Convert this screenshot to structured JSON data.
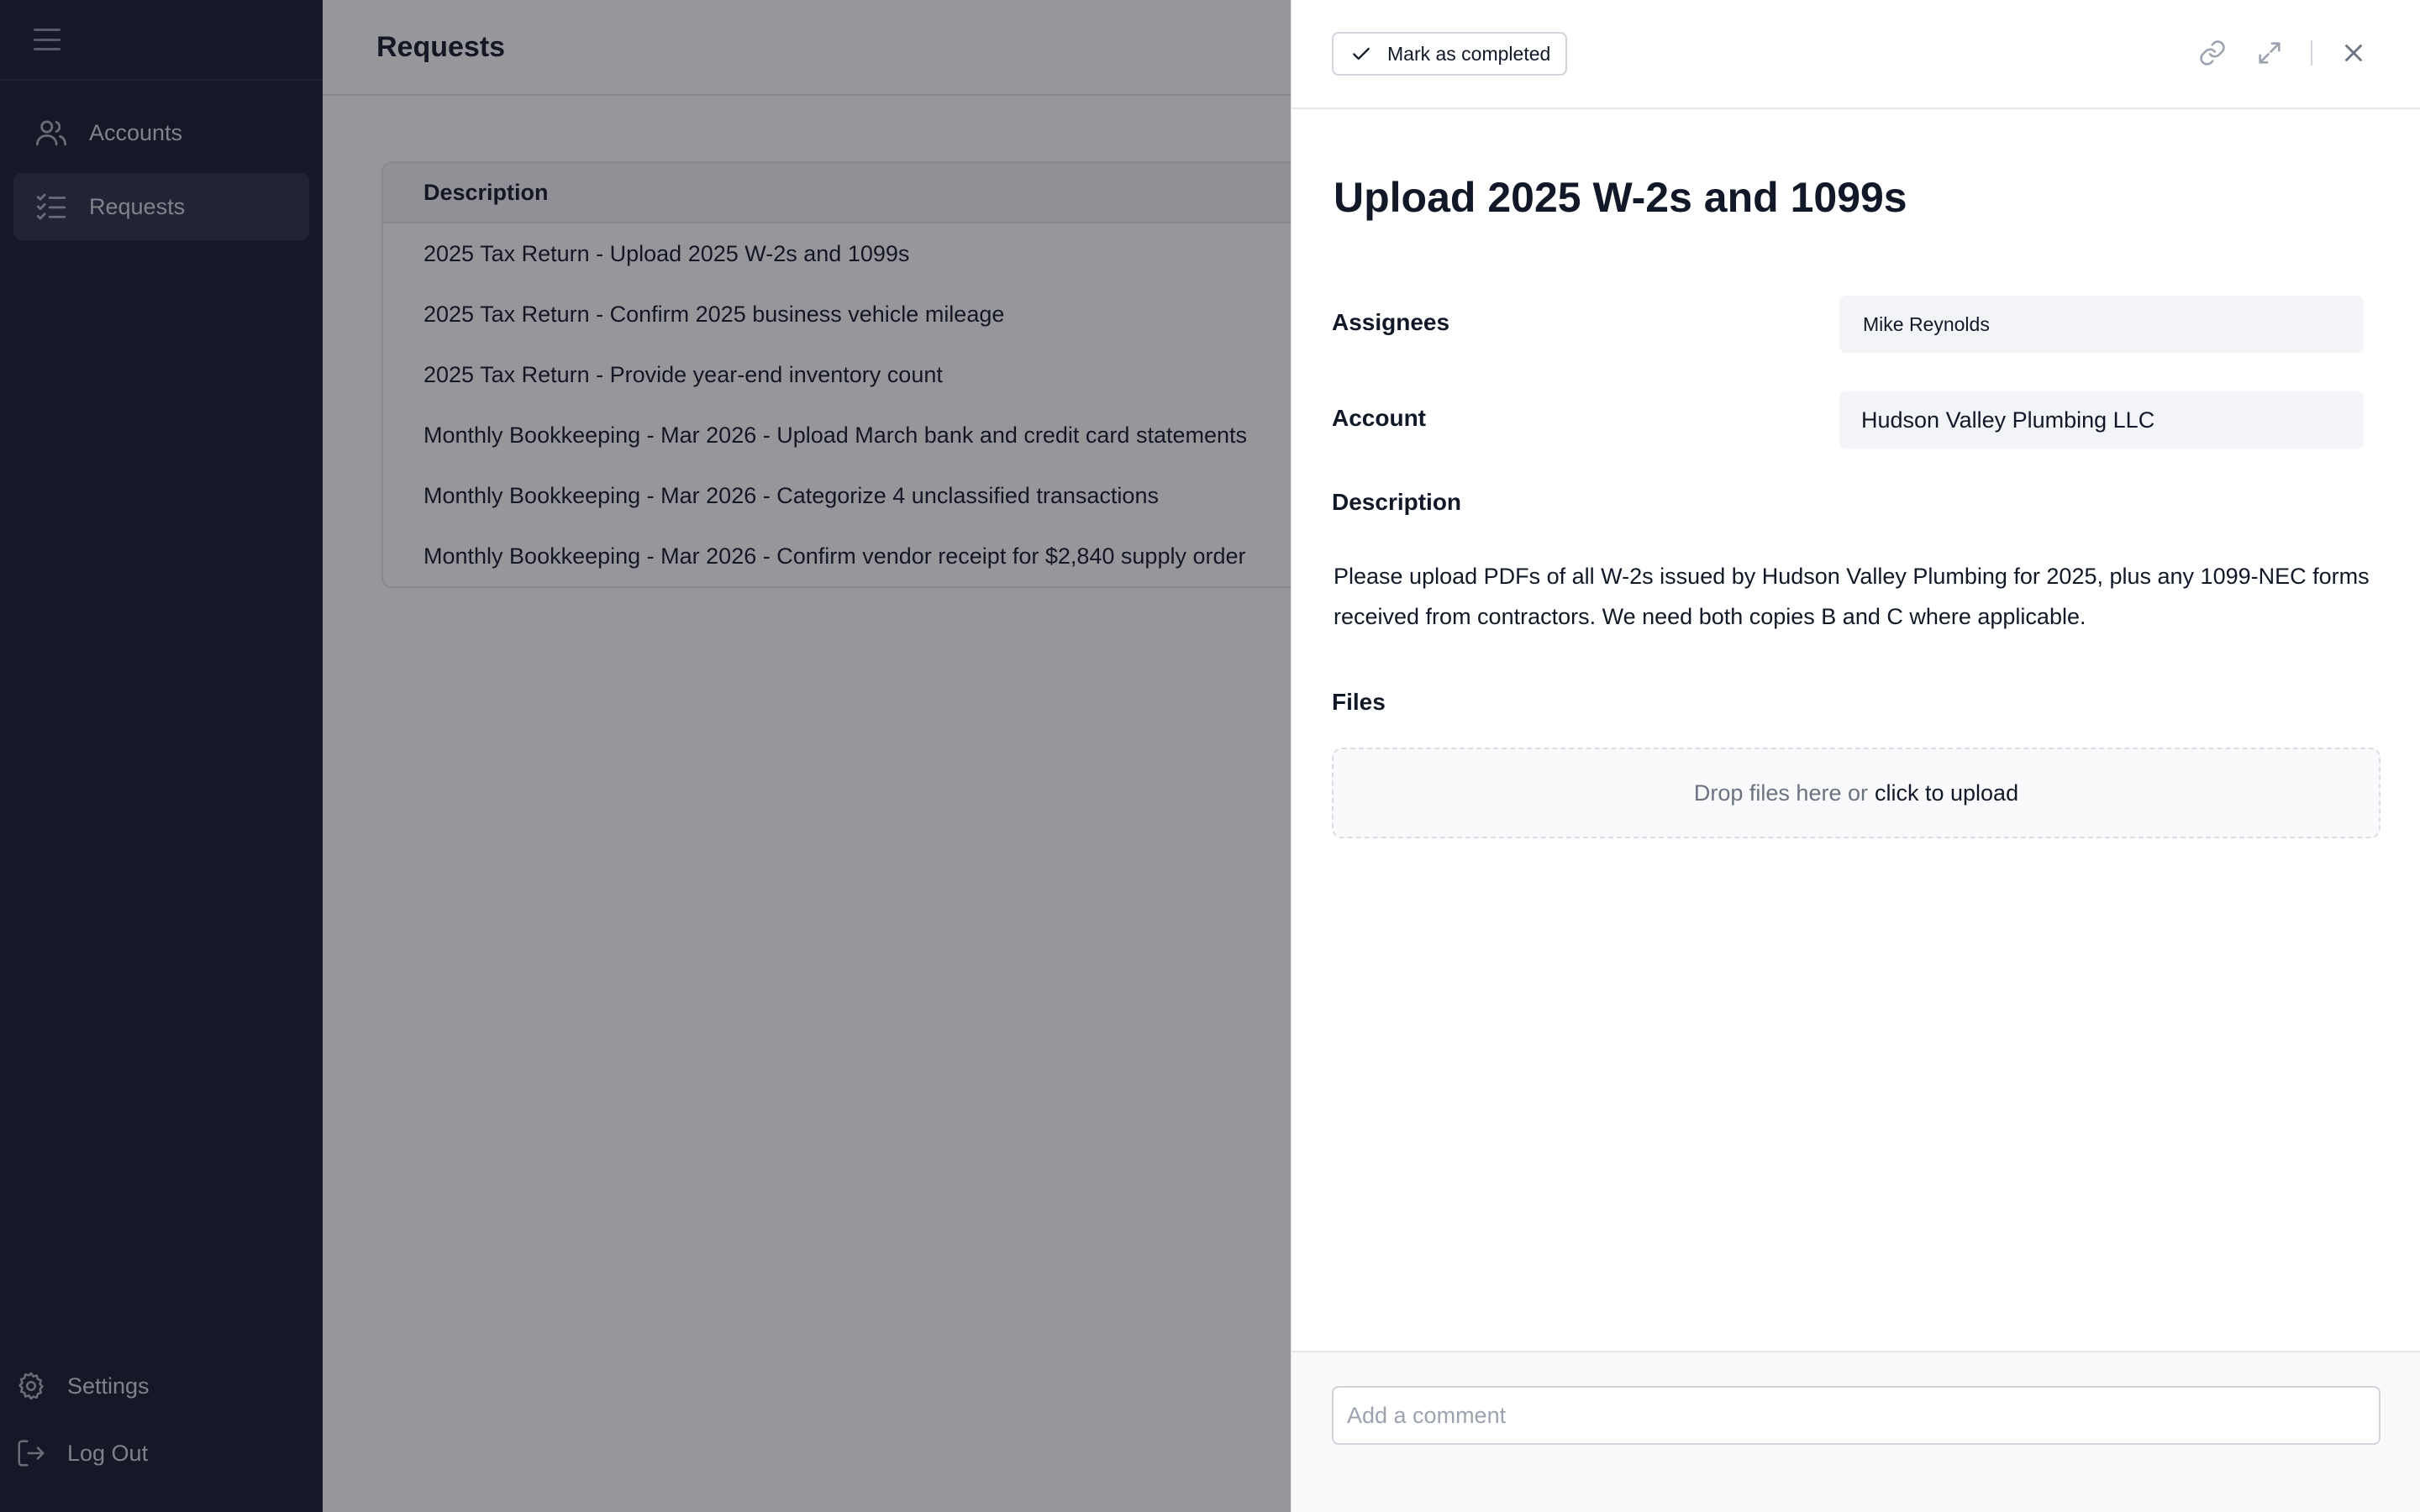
{
  "sidebar": {
    "nav": [
      {
        "label": "Accounts",
        "icon": "users-icon"
      },
      {
        "label": "Requests",
        "icon": "checklist-icon"
      }
    ],
    "bottom": [
      {
        "label": "Settings",
        "icon": "gear-icon"
      },
      {
        "label": "Log Out",
        "icon": "logout-icon"
      }
    ]
  },
  "main": {
    "title": "Requests",
    "table": {
      "header": "Description",
      "rows": [
        "2025 Tax Return - Upload 2025 W-2s and 1099s",
        "2025 Tax Return - Confirm 2025 business vehicle mileage",
        "2025 Tax Return - Provide year-end inventory count",
        "Monthly Bookkeeping - Mar 2026 - Upload March bank and credit card statements",
        "Monthly Bookkeeping - Mar 2026 - Categorize 4 unclassified transactions",
        "Monthly Bookkeeping - Mar 2026 - Confirm vendor receipt for $2,840 supply order"
      ]
    }
  },
  "panel": {
    "complete_label": "Mark as completed",
    "title": "Upload 2025 W-2s and 1099s",
    "assignees_label": "Assignees",
    "assignee": "Mike Reynolds",
    "account_label": "Account",
    "account": "Hudson Valley Plumbing LLC",
    "description_label": "Description",
    "description": "Please upload PDFs of all W-2s issued by Hudson Valley Plumbing for 2025, plus any 1099-NEC forms received from contractors. We need both copies B and C where applicable.",
    "files_label": "Files",
    "drop_text": "Drop files here or",
    "upload_link": "click to upload",
    "comment_placeholder": "Add a comment"
  },
  "colors": {
    "sidebar_bg": "#141a2e",
    "sidebar_active": "#2a3045",
    "overlay": "rgba(25,22,33,0.45)"
  }
}
